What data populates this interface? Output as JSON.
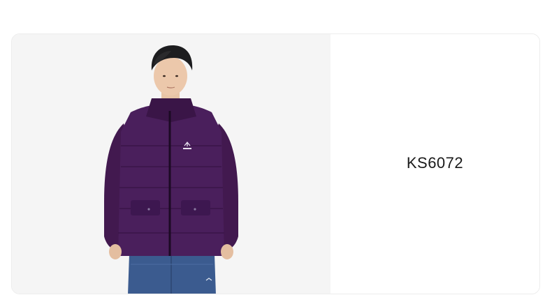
{
  "product": {
    "code": "KS6072",
    "jacket_color": "#4a1f5c",
    "pants_color": "#3b5b8f",
    "background_color": "#f5f5f5"
  }
}
